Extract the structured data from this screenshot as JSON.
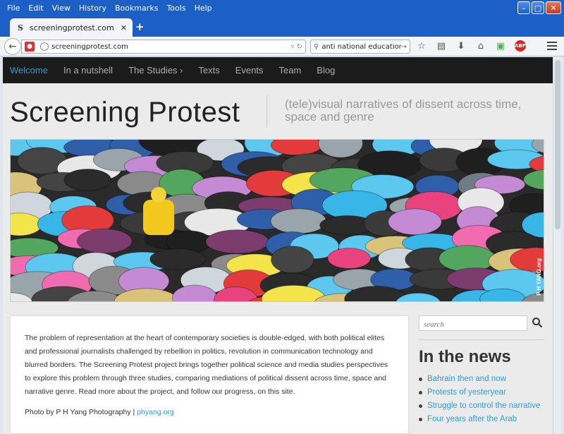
{
  "browser": {
    "menu": [
      "File",
      "Edit",
      "View",
      "History",
      "Bookmarks",
      "Tools",
      "Help"
    ],
    "tab_title": "screeningprotest.com",
    "tab_favicon": "S",
    "url": "screeningprotest.com",
    "search_text": "anti national education prot",
    "window_controls": [
      "minimize-icon",
      "maximize-icon",
      "close-icon"
    ],
    "toolbar_icons": [
      "bookmark-star-icon",
      "reading-list-icon",
      "download-icon",
      "home-icon",
      "sync-icon",
      "adblock-icon",
      "menu-icon"
    ]
  },
  "site": {
    "nav": [
      "Welcome",
      "In a nutshell",
      "The Studies ›",
      "Texts",
      "Events",
      "Team",
      "Blog"
    ],
    "active_nav": "Welcome",
    "title": "Screening Protest",
    "tagline": "(tele)visual narratives of dissent across time, space and genre",
    "hero_credit": "P H YANG.org",
    "intro": {
      "paragraph": "The problem of representation at the heart of contemporary societies is double-edged, with both political elites and professional journalists challenged by rebellion in politics, revolution in communication technology and blurred borders. The Screening Protest project brings together political science and media studies perspectives to explore this problem through three studies, comparing mediations of political dissent across time, space and narrative genre. Read more about the project, and follow our progress, on this site.",
      "photo_credit_prefix": "Photo by P H Yang Photography |",
      "photo_credit_link": "phyang.org"
    },
    "sidebar": {
      "search_placeholder": "search",
      "news_heading": "In the news",
      "news_items": [
        "Bahrain then and now",
        "Protests of yesteryear",
        "Struggle to control the narrative",
        "Four years after the Arab"
      ]
    },
    "colors": {
      "accent": "#2a9fd6",
      "navbar": "#1b1b1b"
    }
  }
}
